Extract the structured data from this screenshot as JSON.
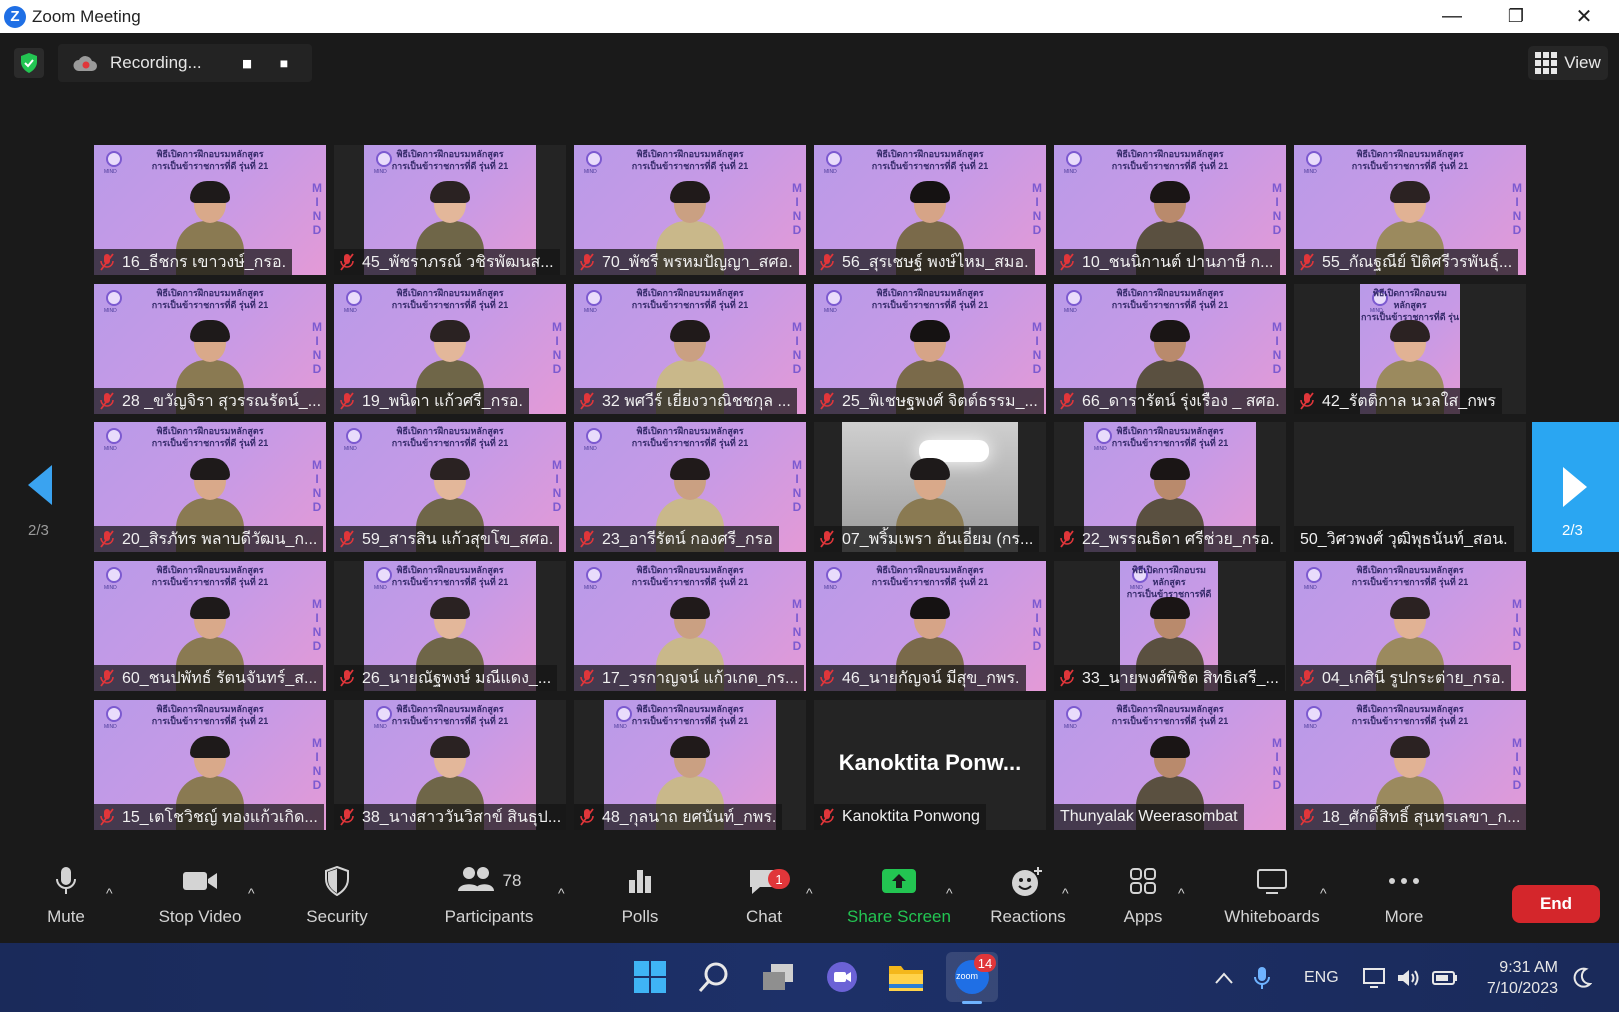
{
  "window": {
    "app_icon": "Z",
    "title": "Zoom Meeting",
    "controls": {
      "minimize": "—",
      "restore": "❐",
      "close": "✕"
    }
  },
  "recording": {
    "label": "Recording...",
    "pause_icon": "▮▮",
    "stop_icon": "■"
  },
  "view": {
    "label": "View"
  },
  "gallery": {
    "page_left": "2/3",
    "page_right": "2/3",
    "slide_header_line1": "พิธีเปิดการฝึกอบรมหลักสูตร",
    "slide_header_line2": "การเป็นข้าราชการที่ดี รุ่นที่ 21",
    "slide_mind_letters": [
      "M",
      "I",
      "N",
      "D"
    ],
    "slide_logo_text": "MIND",
    "tiles": [
      {
        "name": "16_ธีชกร เขาวงษ์_กรอ.",
        "muted": true
      },
      {
        "name": "45_พัชราภรณ์ วชิรพัฒนส...",
        "muted": true
      },
      {
        "name": "70_พัชรี พรหมปัญญา_สศอ.",
        "muted": true
      },
      {
        "name": "56_สุรเชษฐ์ พงษ์ไหม_สมอ.",
        "muted": true
      },
      {
        "name": "10_ชนนิกานต์ ปานภาษี ก...",
        "muted": true
      },
      {
        "name": "55_กัณฐณีย์ ปิติศรีวรพันธุ์...",
        "muted": true
      },
      {
        "name": "28 _ขวัญจิรา สุวรรณรัตน์_...",
        "muted": true
      },
      {
        "name": "19_พนิดา แก้วศรี_กรอ.",
        "muted": true
      },
      {
        "name": "32 พศวีร์ เยี่ยงวาณิชชกุล ...",
        "muted": true
      },
      {
        "name": "25_พิเชษฐพงศ์ จิตต์ธรรม_...",
        "muted": true
      },
      {
        "name": "66_ดารารัตน์ รุ่งเรือง _ สศอ.",
        "muted": true
      },
      {
        "name": "42_รัตติกาล นวลใส_กพร",
        "muted": true
      },
      {
        "name": "20_สิรภัทร พลาบดีวัฒน_ก...",
        "muted": true
      },
      {
        "name": "59_สารสิน แก้วสุขโข_สศอ.",
        "muted": true
      },
      {
        "name": "23_อารีรัตน์ กองศรี_กรอ",
        "muted": true
      },
      {
        "name": "07_พริ้มเพรา อันเอี่ยม (กร...",
        "muted": true
      },
      {
        "name": "22_พรรณธิดา ศรีช่วย_กรอ.",
        "muted": true
      },
      {
        "name": "50_วิศวพงศ์ วุฒิพุธนันท์_สอน.",
        "muted": false
      },
      {
        "name": "60_ชนปพัทธ์ รัตนจันทร์_ส...",
        "muted": true
      },
      {
        "name": "26_นายณัฐพงษ์ มณีแดง_...",
        "muted": true
      },
      {
        "name": "17_วรกาญจน์ แก้วเกต_กร...",
        "muted": true
      },
      {
        "name": "46_นายกัญจน์ มีสุข_กพร.",
        "muted": true
      },
      {
        "name": "33_นายพงศ์พิชิต สิทธิเสรี_...",
        "muted": true
      },
      {
        "name": "04_เกศินี รูปกระต่าย_กรอ.",
        "muted": true
      },
      {
        "name": "15_เตโชวิชญ์ ทองแก้วเกิด...",
        "muted": true
      },
      {
        "name": "38_นางสาววันวิสาข์ สินธุป...",
        "muted": true
      },
      {
        "name": "48_กุลนาถ ยศนันท์_กพร.",
        "muted": true
      },
      {
        "name": "Kanoktita Ponwong",
        "muted": true,
        "display": "Kanoktita  Ponw..."
      },
      {
        "name": "Thunyalak Weerasombat",
        "muted": false
      },
      {
        "name": "18_ศักดิ์สิทธิ์ สุนทรเลขา_ก...",
        "muted": true
      }
    ]
  },
  "toolbar": {
    "mute": "Mute",
    "stop_video": "Stop Video",
    "security": "Security",
    "participants": "Participants",
    "participants_count": "78",
    "polls": "Polls",
    "chat": "Chat",
    "chat_badge": "1",
    "share_screen": "Share Screen",
    "reactions": "Reactions",
    "apps": "Apps",
    "whiteboards": "Whiteboards",
    "more": "More",
    "end": "End",
    "caret": "^",
    "share_color": "#23c552",
    "end_color": "#d4262b"
  },
  "taskbar": {
    "zoom_badge": "14",
    "zoom_label": "zoom",
    "lang": "ENG",
    "time": "9:31 AM",
    "date": "7/10/2023"
  }
}
